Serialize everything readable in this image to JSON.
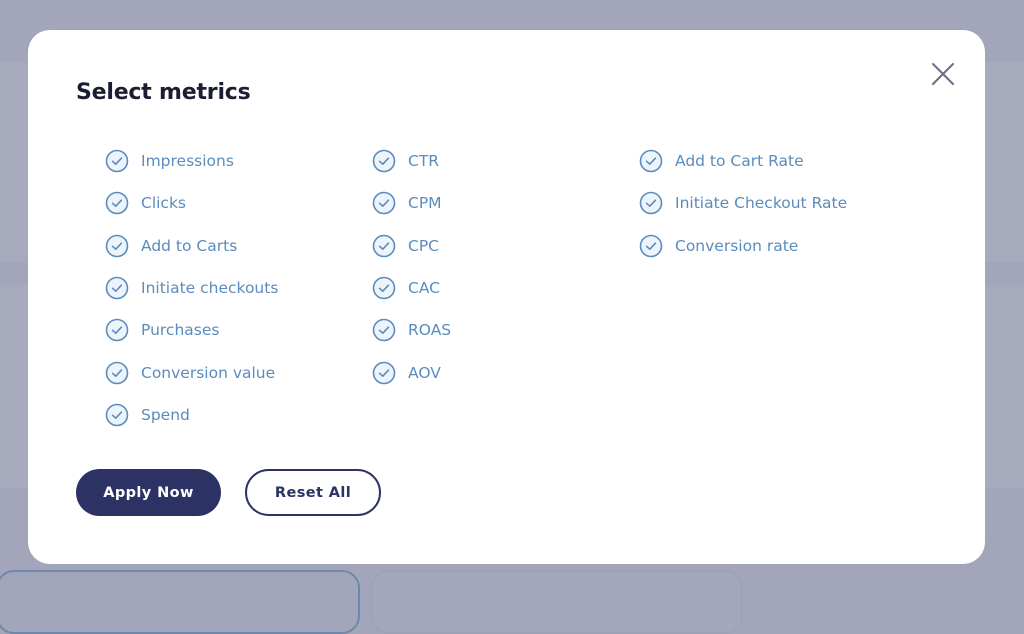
{
  "modal": {
    "title": "Select metrics",
    "close_icon": "close-icon",
    "columns": [
      {
        "items": [
          {
            "label": "Impressions",
            "checked": true
          },
          {
            "label": "Clicks",
            "checked": true
          },
          {
            "label": "Add to Carts",
            "checked": true
          },
          {
            "label": "Initiate checkouts",
            "checked": true
          },
          {
            "label": "Purchases",
            "checked": true
          },
          {
            "label": "Conversion value",
            "checked": true
          },
          {
            "label": "Spend",
            "checked": true
          }
        ]
      },
      {
        "items": [
          {
            "label": "CTR",
            "checked": true
          },
          {
            "label": "CPM",
            "checked": true
          },
          {
            "label": "CPC",
            "checked": true
          },
          {
            "label": "CAC",
            "checked": true
          },
          {
            "label": "ROAS",
            "checked": true
          },
          {
            "label": "AOV",
            "checked": true
          }
        ]
      },
      {
        "items": [
          {
            "label": "Add to Cart Rate",
            "checked": true
          },
          {
            "label": "Initiate Checkout Rate",
            "checked": true
          },
          {
            "label": "Conversion rate",
            "checked": true
          }
        ]
      }
    ],
    "buttons": {
      "apply_label": "Apply Now",
      "reset_label": "Reset All"
    }
  },
  "colors": {
    "overlay": "#a3a6ba",
    "accent_navy": "#2c3263",
    "check_blue": "#5a8cbd",
    "title_text": "#1b1d33"
  }
}
